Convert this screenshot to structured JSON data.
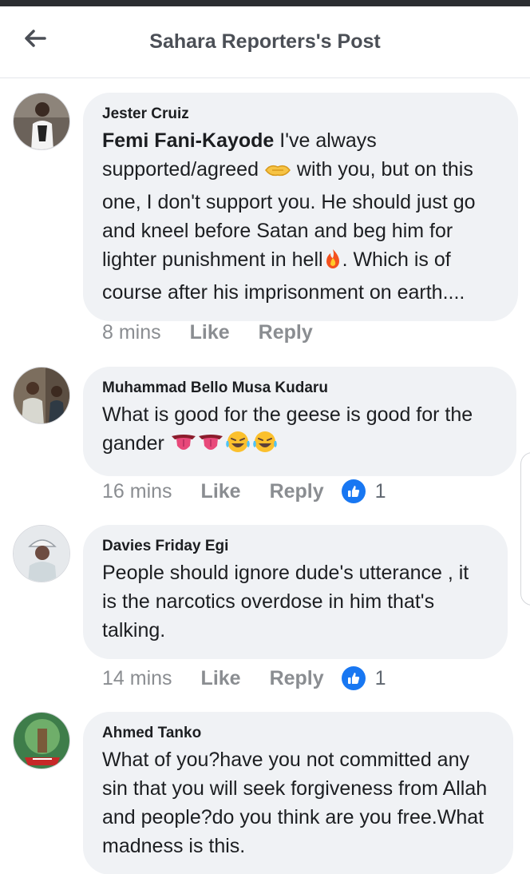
{
  "header": {
    "title": "Sahara Reporters's Post",
    "back_icon": "arrow-left-icon"
  },
  "colors": {
    "bubble": "#f0f2f5",
    "meta_text": "#8a8d91",
    "like_blue": "#1877f2",
    "title": "#4b4f56"
  },
  "comments": [
    {
      "author": "Jester Cruiz",
      "mention": "Femi Fani-Kayode",
      "text_a": " I've always supported/agreed ",
      "text_b": " with you, but on this one, I don't support you. He should just go and kneel before Satan and beg him for lighter punishment in hell",
      "text_c": ". Which is of course after his imprisonment on earth....",
      "emojis": [
        "handshake-icon",
        "fire-icon"
      ],
      "time": "8 mins",
      "like_label": "Like",
      "reply_label": "Reply"
    },
    {
      "author": "Muhammad Bello Musa Kudaru",
      "text": "What is good for the geese is good for the gander ",
      "emojis": [
        "tongue-icon",
        "tongue-icon",
        "laughing-tears-icon",
        "laughing-tears-icon"
      ],
      "time": "16 mins",
      "like_label": "Like",
      "reply_label": "Reply",
      "reactions": "1"
    },
    {
      "author": "Davies Friday Egi",
      "text": "People should ignore dude's utterance , it is the narcotics overdose in him that's talking.",
      "time": "14 mins",
      "like_label": "Like",
      "reply_label": "Reply",
      "reactions": "1"
    },
    {
      "author": "Ahmed Tanko",
      "text": "What of you?have you not committed any sin that you will seek forgiveness from Allah and people?do you think are you free.What madness is this."
    }
  ]
}
